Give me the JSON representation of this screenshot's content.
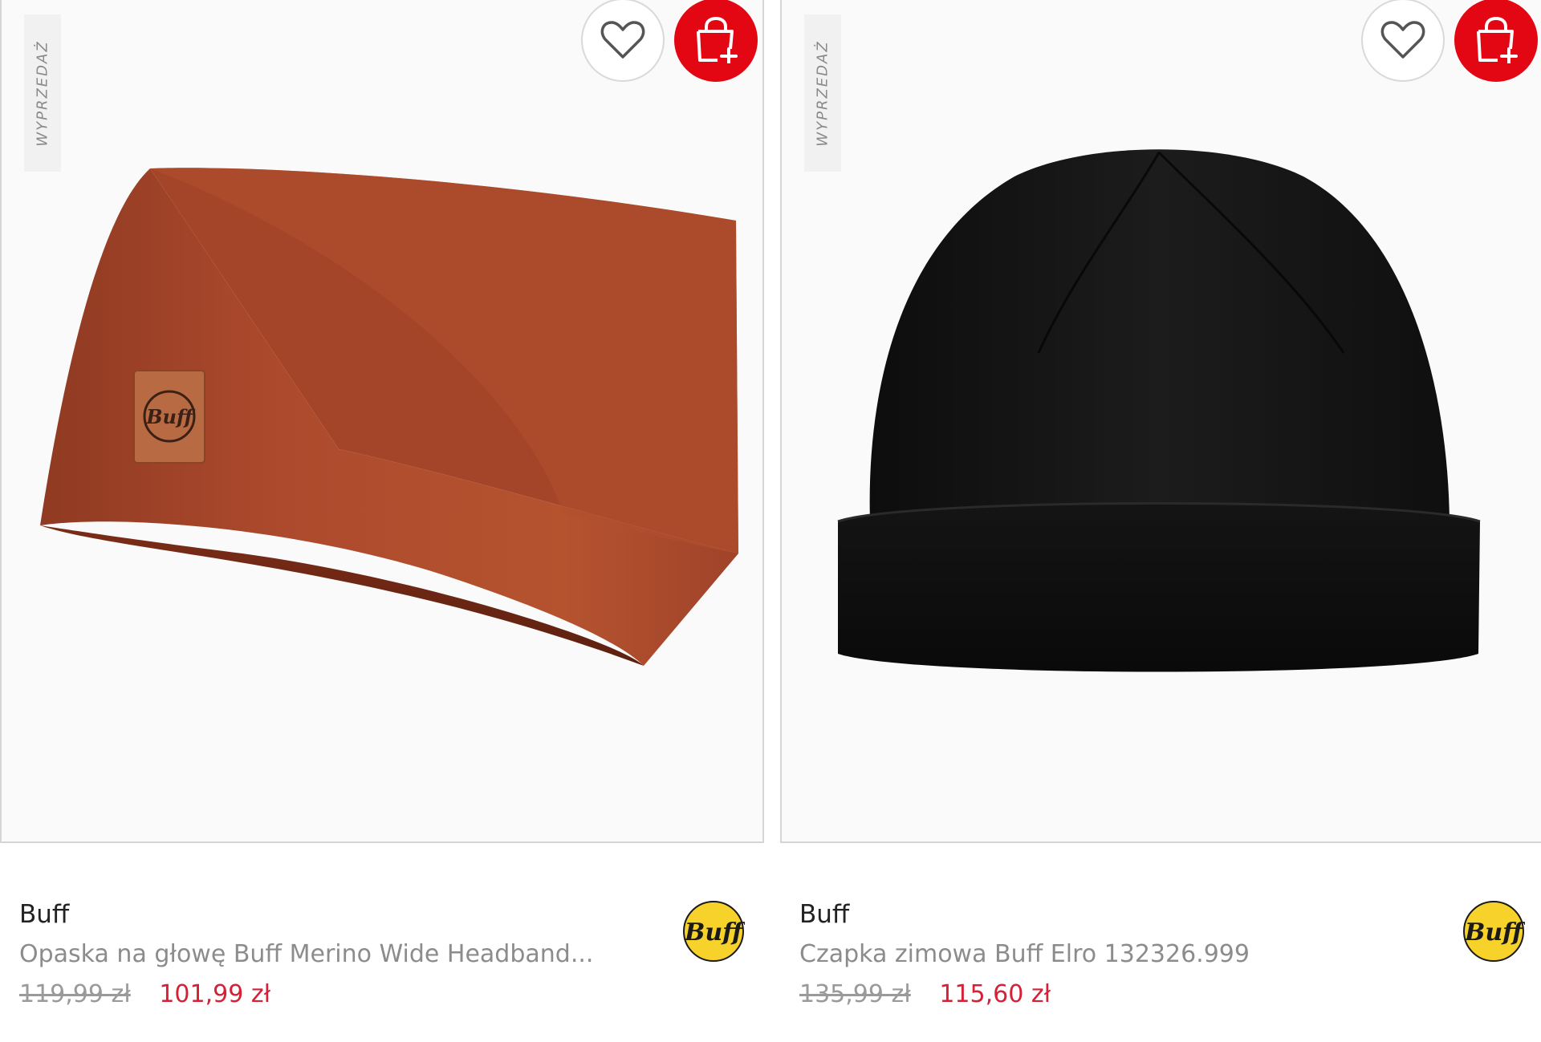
{
  "products": [
    {
      "sale_label": "WYPRZEDAŻ",
      "brand": "Buff",
      "name": "Opaska na głowę Buff Merino Wide Headband...",
      "old_price": "119,99 zł",
      "new_price": "101,99 zł",
      "image_icon": "headband-image",
      "product_color": "#a8452a",
      "logo_text": "Buff"
    },
    {
      "sale_label": "WYPRZEDAŻ",
      "brand": "Buff",
      "name": "Czapka zimowa Buff Elro 132326.999",
      "old_price": "135,99 zł",
      "new_price": "115,60 zł",
      "image_icon": "beanie-image",
      "product_color": "#141414",
      "logo_text": "Buff"
    }
  ],
  "colors": {
    "accent_red": "#e30613",
    "price_red": "#d62036",
    "logo_yellow": "#f6d22a"
  }
}
